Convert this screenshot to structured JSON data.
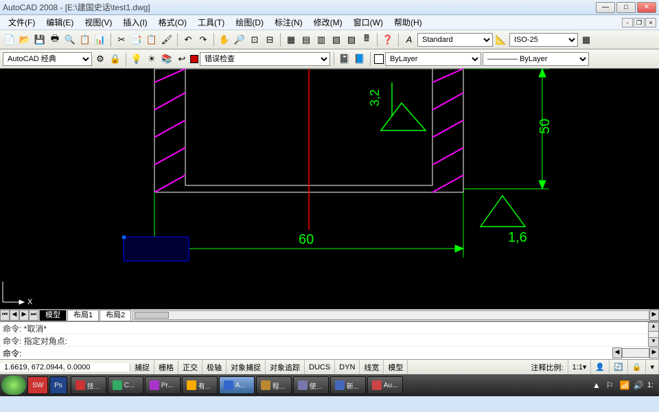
{
  "title": "AutoCAD 2008 - [E:\\建国史话\\test1.dwg]",
  "menu": [
    "文件(F)",
    "编辑(E)",
    "视图(V)",
    "插入(I)",
    "格式(O)",
    "工具(T)",
    "绘图(D)",
    "标注(N)",
    "修改(M)",
    "窗口(W)",
    "帮助(H)"
  ],
  "toolbar2": {
    "workspace": "AutoCAD 经典",
    "error_check": "错误检查",
    "layer": "ByLayer",
    "linetype": "ByLayer"
  },
  "styles": {
    "text_style": "Standard",
    "dim_style": "ISO-25"
  },
  "drawing": {
    "dim_horizontal": "60",
    "dim_vertical": "50",
    "surface1": "3,2",
    "surface2": "1,6",
    "axis_label": "X"
  },
  "tabs": [
    "模型",
    "布局1",
    "布局2"
  ],
  "command": {
    "line1": "命令:  *取消*",
    "line2": "命令:  指定对角点:",
    "prompt": "命令:"
  },
  "status": {
    "coords": "1.6619, 672.0944, 0.0000",
    "toggles": [
      "捕捉",
      "栅格",
      "正交",
      "极轴",
      "对象捕捉",
      "对象追踪",
      "DUCS",
      "DYN",
      "线宽",
      "模型"
    ],
    "anno_label": "注释比例:",
    "anno_scale": "1:1"
  },
  "taskbar": {
    "items": [
      {
        "label": "技...",
        "color": "#c33"
      },
      {
        "label": "C...",
        "color": "#3a6"
      },
      {
        "label": "Pr...",
        "color": "#a3c"
      },
      {
        "label": "有...",
        "color": "#fa0"
      },
      {
        "label": "A...",
        "color": "#36c"
      },
      {
        "label": "程...",
        "color": "#b83"
      },
      {
        "label": "使...",
        "color": "#77a"
      },
      {
        "label": "新...",
        "color": "#46b"
      },
      {
        "label": "Au...",
        "color": "#c44"
      }
    ],
    "quick": [
      "SW",
      "Ps"
    ],
    "time": "1:"
  }
}
